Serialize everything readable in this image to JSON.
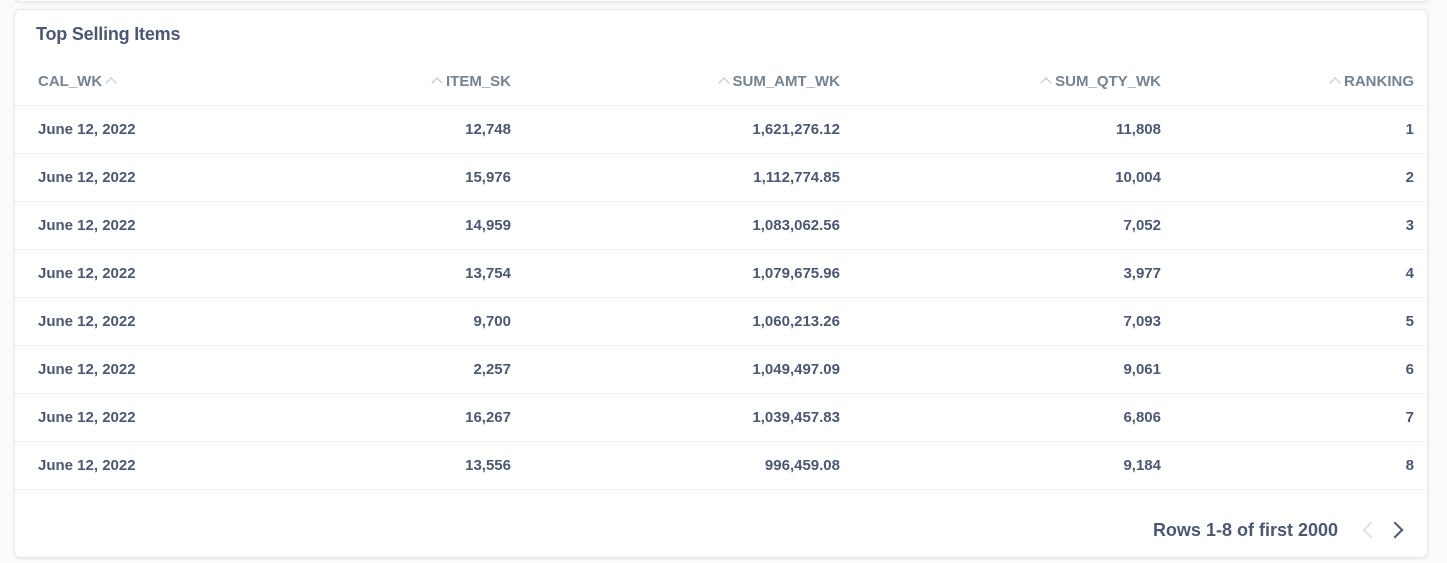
{
  "card": {
    "title": "Top Selling Items"
  },
  "table": {
    "columns": [
      {
        "label": "CAL_WK",
        "align": "left"
      },
      {
        "label": "ITEM_SK",
        "align": "right"
      },
      {
        "label": "SUM_AMT_WK",
        "align": "right"
      },
      {
        "label": "SUM_QTY_WK",
        "align": "right"
      },
      {
        "label": "RANKING",
        "align": "right"
      }
    ],
    "rows": [
      [
        "June 12, 2022",
        "12,748",
        "1,621,276.12",
        "11,808",
        "1"
      ],
      [
        "June 12, 2022",
        "15,976",
        "1,112,774.85",
        "10,004",
        "2"
      ],
      [
        "June 12, 2022",
        "14,959",
        "1,083,062.56",
        "7,052",
        "3"
      ],
      [
        "June 12, 2022",
        "13,754",
        "1,079,675.96",
        "3,977",
        "4"
      ],
      [
        "June 12, 2022",
        "9,700",
        "1,060,213.26",
        "7,093",
        "5"
      ],
      [
        "June 12, 2022",
        "2,257",
        "1,049,497.09",
        "9,061",
        "6"
      ],
      [
        "June 12, 2022",
        "16,267",
        "1,039,457.83",
        "6,806",
        "7"
      ],
      [
        "June 12, 2022",
        "13,556",
        "996,459.08",
        "9,184",
        "8"
      ]
    ]
  },
  "pagination": {
    "label": "Rows 1-8 of first 2000",
    "prev_icon": "chevron-left-icon",
    "next_icon": "chevron-right-icon",
    "prev_enabled": false,
    "next_enabled": true
  },
  "colors": {
    "text": "#4c5773",
    "header_text": "#74838f",
    "border": "#f0f0f0"
  }
}
